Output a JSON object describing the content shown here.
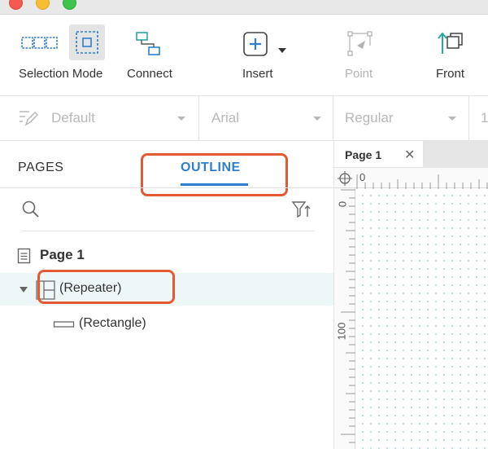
{
  "toolbar": {
    "selection_mode_label": "Selection Mode",
    "connect_label": "Connect",
    "insert_label": "Insert",
    "point_label": "Point",
    "front_label": "Front"
  },
  "format_bar": {
    "style_value": "Default",
    "font_family_value": "Arial",
    "font_weight_value": "Regular",
    "font_size_partial": "1"
  },
  "left_panel": {
    "tabs": [
      {
        "label": "PAGES",
        "active": false
      },
      {
        "label": "OUTLINE",
        "active": true
      }
    ],
    "outline_tree": [
      {
        "label": "Page 1",
        "type": "page"
      },
      {
        "label": "(Repeater)",
        "type": "repeater",
        "selected": true,
        "expanded": true
      },
      {
        "label": "(Rectangle)",
        "type": "rectangle"
      }
    ]
  },
  "canvas": {
    "doc_tab_label": "Page 1",
    "ruler_top_zero": "0",
    "ruler_left_zero": "0",
    "ruler_left_100": "100"
  },
  "colors": {
    "accent_blue": "#2e7fd1",
    "annotation_red": "#e45a35",
    "selected_row_bg": "#eef7f8",
    "grid_dot": "#b9dde0"
  }
}
